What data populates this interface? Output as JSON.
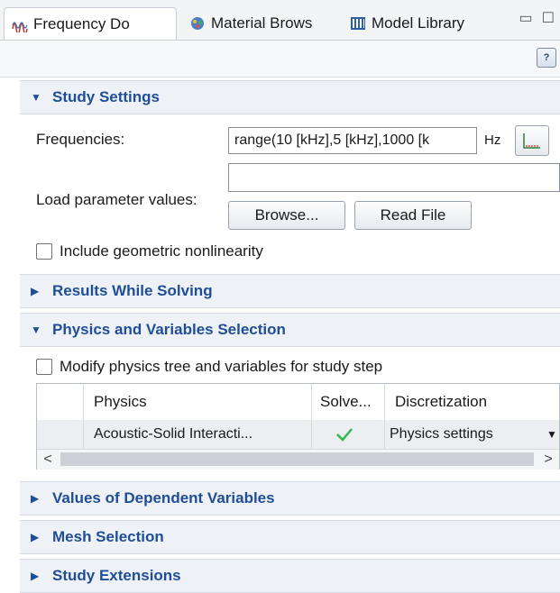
{
  "tabs": [
    {
      "label": "Frequency Do",
      "icon": "frequency-study-icon"
    },
    {
      "label": "Material Brows",
      "icon": "material-icon"
    },
    {
      "label": "Model Library",
      "icon": "model-library-icon"
    }
  ],
  "colors": {
    "section_title": "#1f4e96",
    "section_bg": "#eef2f7",
    "check_mark": "#2db84d"
  },
  "study_settings": {
    "title": "Study Settings",
    "frequencies_label": "Frequencies:",
    "frequencies_value": "range(10 [kHz],5 [kHz],1000 [k",
    "frequencies_unit": "Hz",
    "load_params_label": "Load parameter values:",
    "load_params_value": "",
    "browse_label": "Browse...",
    "read_file_label": "Read File",
    "geom_nonlinearity_label": "Include geometric nonlinearity",
    "geom_nonlinearity_checked": false
  },
  "results_while_solving": {
    "title": "Results While Solving"
  },
  "physics_vars": {
    "title": "Physics and Variables Selection",
    "modify_label": "Modify physics tree and variables for study step",
    "modify_checked": false,
    "table": {
      "headers": [
        "Physics",
        "Solve...",
        "Discretization"
      ],
      "rows": [
        {
          "physics": "Acoustic-Solid Interacti...",
          "solve": true,
          "discretization": "Physics settings"
        }
      ]
    }
  },
  "values_dependent": {
    "title": "Values of Dependent Variables"
  },
  "mesh_selection": {
    "title": "Mesh Selection"
  },
  "study_extensions": {
    "title": "Study Extensions"
  }
}
